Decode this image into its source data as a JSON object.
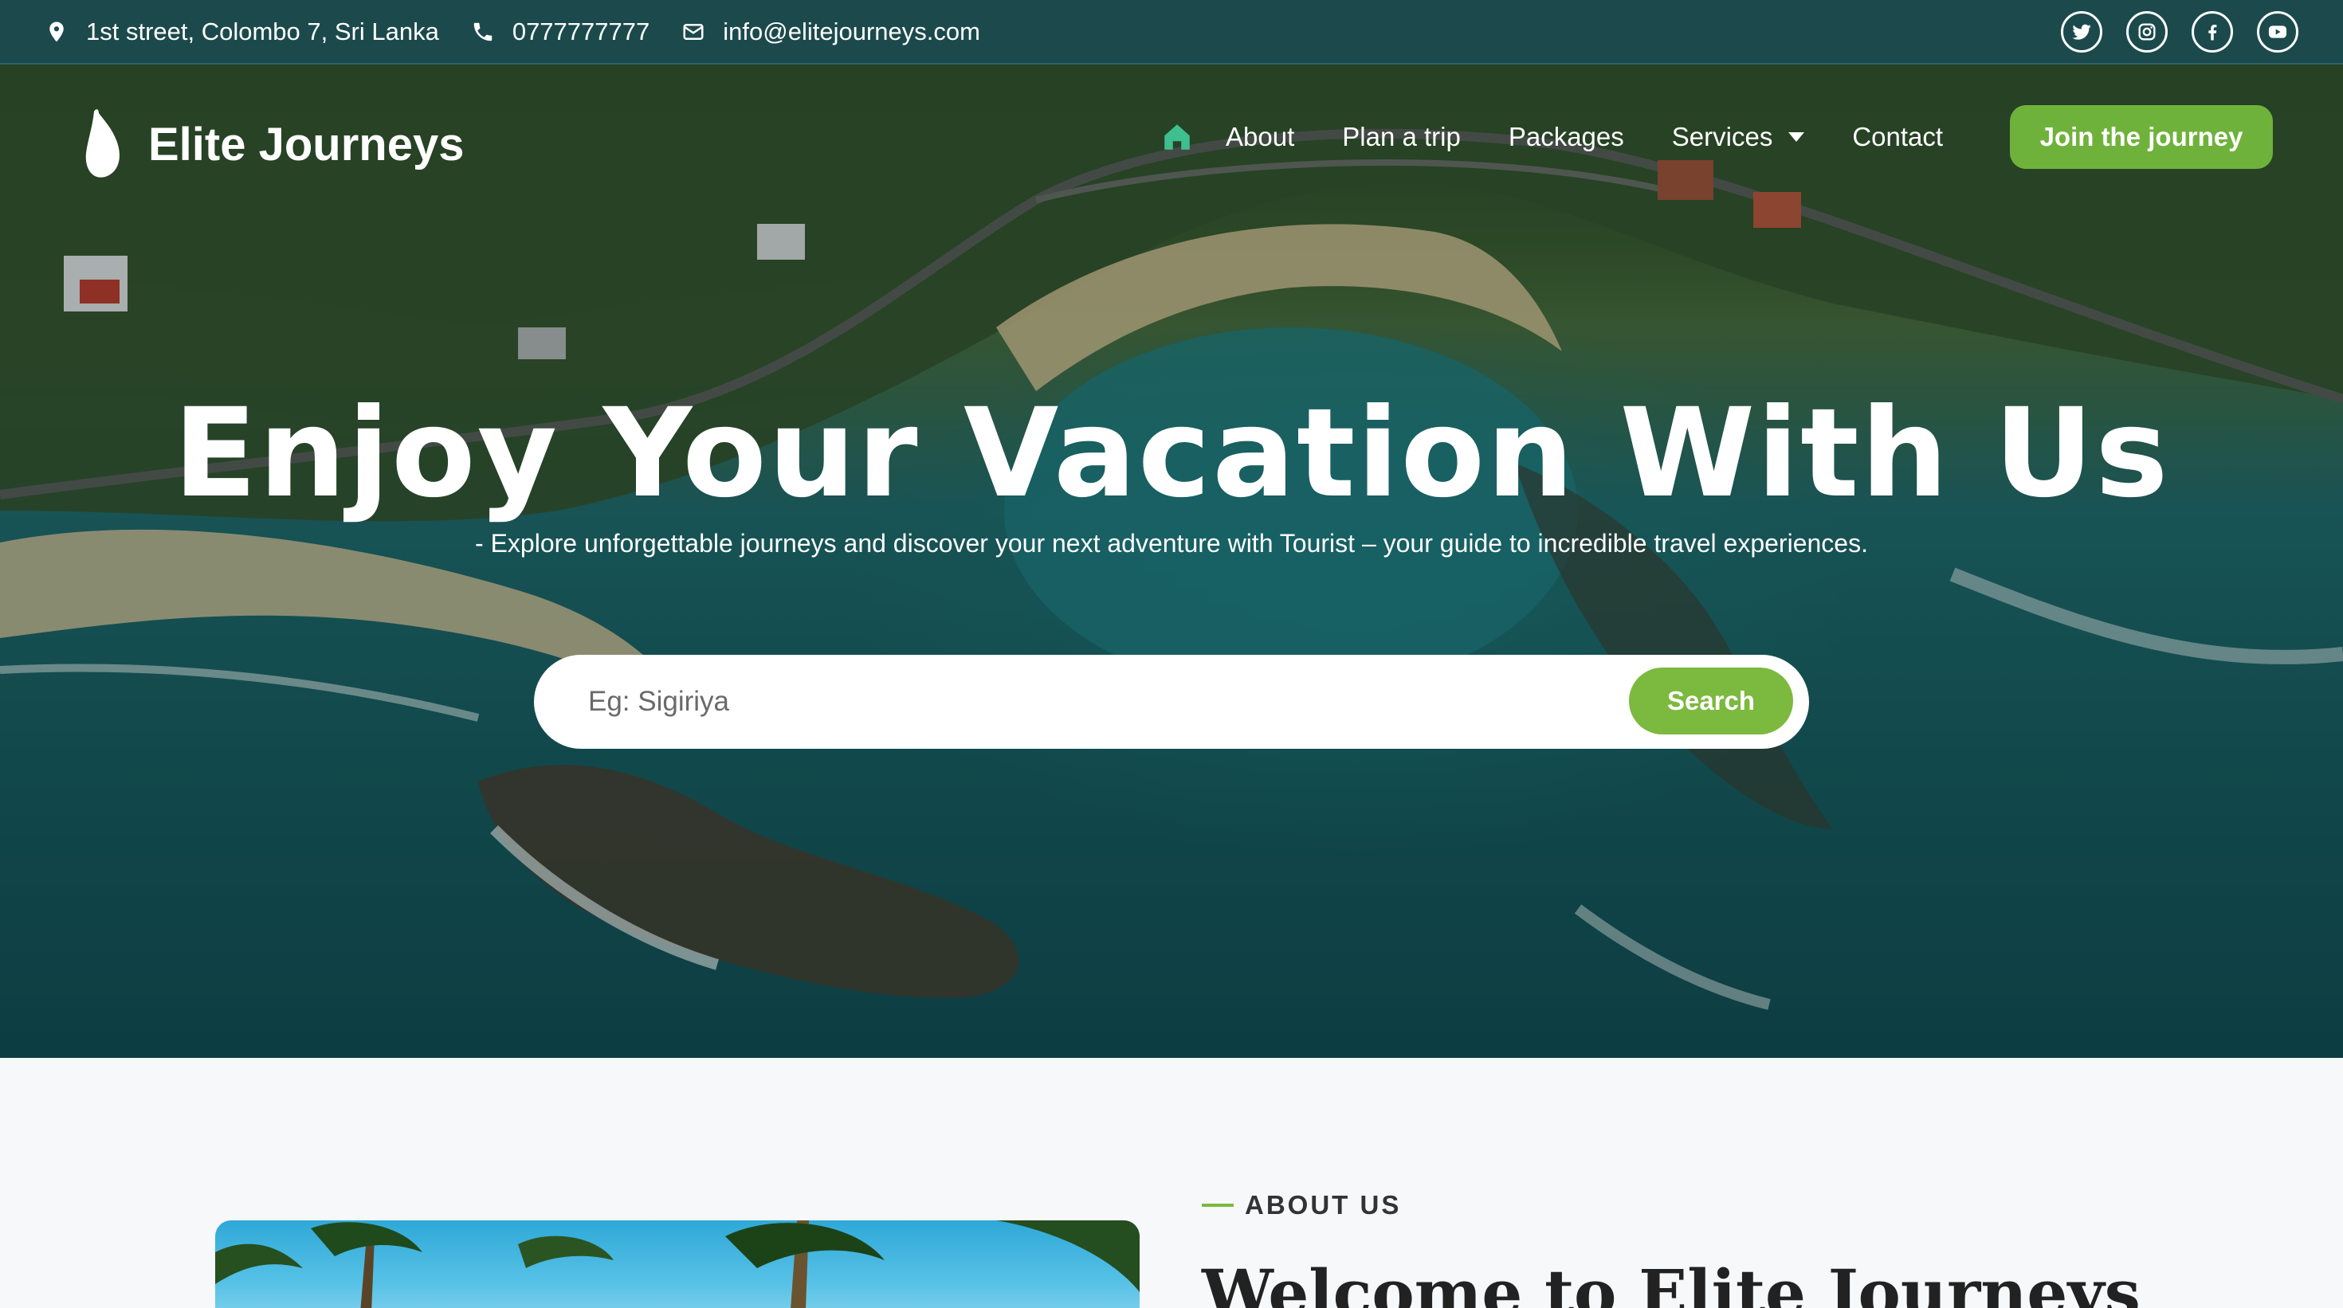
{
  "topbar": {
    "address": "1st street, Colombo 7, Sri Lanka",
    "phone": "0777777777",
    "email": "info@elitejourneys.com",
    "social": [
      "twitter-icon",
      "instagram-icon",
      "facebook-icon",
      "youtube-icon"
    ]
  },
  "nav": {
    "brand": "Elite Journeys",
    "items": [
      {
        "label": "About"
      },
      {
        "label": "Plan a trip"
      },
      {
        "label": "Packages"
      },
      {
        "label": "Services"
      },
      {
        "label": "Contact"
      }
    ],
    "cta": "Join the journey"
  },
  "hero": {
    "title": "Enjoy Your Vacation With Us",
    "subtitle": "- Explore unforgettable journeys and discover your next adventure with Tourist – your guide to incredible travel experiences.",
    "search_placeholder": "Eg: Sigiriya",
    "search_button": "Search"
  },
  "about": {
    "label": "ABOUT US",
    "title": "Welcome to Elite Journeys"
  },
  "colors": {
    "topbar_bg": "#1c4a4c",
    "accent_green": "#6fb23b",
    "home_icon": "#3fbf8f"
  }
}
